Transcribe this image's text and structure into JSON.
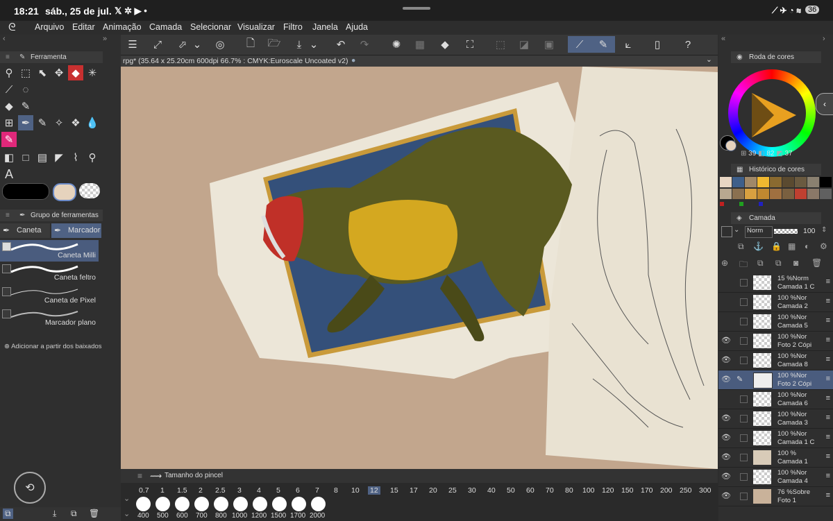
{
  "status": {
    "time": "18:21",
    "date": "sáb., 25 de jul.",
    "battery": "36"
  },
  "menu": [
    "Arquivo",
    "Editar",
    "Animação",
    "Camada",
    "Selecionar",
    "Visualizar",
    "Filtro",
    "Janela",
    "Ajuda"
  ],
  "document": {
    "title": "rpg* (35.64 x 25.20cm 600dpi 66.7% : CMYK:Euroscale Uncoated v2)"
  },
  "left": {
    "tool_panel": "Ferramenta",
    "tool_group_panel": "Grupo de ferramentas",
    "tabs": [
      "Caneta",
      "Marcador"
    ],
    "brushes": [
      "Caneta Milli",
      "Caneta feltro",
      "Caneta de Pixel",
      "Marcador plano"
    ],
    "add_downloads": "Adicionar a partir dos baixados",
    "text_tool": "A"
  },
  "right": {
    "color_wheel_panel": "Roda de cores",
    "color_values": {
      "h": "39",
      "s": "82",
      "v": "37"
    },
    "history_panel": "Histórico de cores",
    "layer_panel": "Camada",
    "blend_mode": "Norm",
    "opacity": "100",
    "layers": [
      {
        "pct": "15 %",
        "mode": "Norm",
        "name": "Camada 1 C",
        "visible": false,
        "selected": false
      },
      {
        "pct": "100 %",
        "mode": "Nor",
        "name": "Camada 2",
        "visible": false,
        "selected": false
      },
      {
        "pct": "100 %",
        "mode": "Nor",
        "name": "Camada 5",
        "visible": false,
        "selected": false
      },
      {
        "pct": "100 %",
        "mode": "Nor",
        "name": "Foto 2 Cópi",
        "visible": true,
        "selected": false
      },
      {
        "pct": "100 %",
        "mode": "Nor",
        "name": "Camada 8",
        "visible": true,
        "selected": false
      },
      {
        "pct": "100 %",
        "mode": "Nor",
        "name": "Foto 2 Cópi",
        "visible": true,
        "selected": true
      },
      {
        "pct": "100 %",
        "mode": "Nor",
        "name": "Camada 6",
        "visible": false,
        "selected": false
      },
      {
        "pct": "100 %",
        "mode": "Nor",
        "name": "Camada 3",
        "visible": true,
        "selected": false
      },
      {
        "pct": "100 %",
        "mode": "Nor",
        "name": "Camada 1 C",
        "visible": true,
        "selected": false
      },
      {
        "pct": "100 %",
        "mode": "",
        "name": "Camada 1",
        "visible": true,
        "selected": false
      },
      {
        "pct": "100 %",
        "mode": "Nor",
        "name": "Camada 4",
        "visible": true,
        "selected": false
      },
      {
        "pct": "76 %",
        "mode": "Sobre",
        "name": "Foto 1",
        "visible": true,
        "selected": false
      }
    ]
  },
  "brush_size": {
    "panel": "Tamanho do pincel",
    "values": [
      "0.7",
      "1",
      "1.5",
      "2",
      "2.5",
      "3",
      "4",
      "5",
      "6",
      "7",
      "8",
      "10",
      "12",
      "15",
      "17",
      "20",
      "25",
      "30",
      "40",
      "50",
      "60",
      "70",
      "80",
      "100",
      "120",
      "150",
      "170",
      "200",
      "250",
      "300"
    ],
    "selected": "12",
    "big_values": [
      "400",
      "500",
      "600",
      "700",
      "800",
      "1000",
      "1200",
      "1500",
      "1700",
      "2000"
    ]
  },
  "colors": {
    "accent": "#4f6284",
    "canvas_bg": "#c2a68d",
    "main_color": "#000000",
    "sub_color": "#e6d3bd"
  },
  "history_colors": [
    "#e8d6c3",
    "#3e5f8a",
    "#a08868",
    "#f0b830",
    "#8a6a30",
    "#5a4a30",
    "#6a5a40",
    "#8a8070",
    "#000000",
    "#b8a890",
    "#8a7050",
    "#d8a040",
    "#c08830",
    "#a07040",
    "#7a6040",
    "#c04030",
    "#8a7868",
    "#606060",
    "#c02020",
    "#20a020",
    "#2020c0"
  ]
}
